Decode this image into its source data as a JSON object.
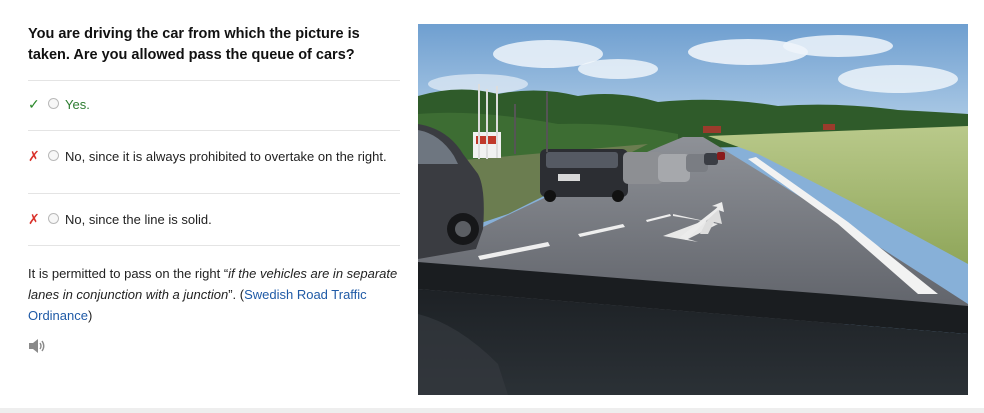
{
  "question": "You are driving the car from which the picture is taken. Are you allowed pass the queue of cars?",
  "answers": [
    {
      "mark": "✓",
      "text": "Yes.",
      "status": "correct"
    },
    {
      "mark": "✗",
      "text": "No, since it is always prohibited to overtake on the right.",
      "status": "wrong"
    },
    {
      "mark": "✗",
      "text": "No, since the line is solid.",
      "status": "wrong"
    }
  ],
  "explanation": {
    "intro": "It is permitted to pass on the right “",
    "quote": "if the vehicles are in separate lanes in conjunction with a junction",
    "outro": "”. (",
    "source_link": "Swedish Road Traffic Ordinance",
    "close": ")"
  },
  "speaker_icon": "speaker-icon",
  "photo_description_icon": "road-photo",
  "colors": {
    "correct": "#2e7d32",
    "wrong": "#d9322b",
    "link": "#1f5aa6"
  }
}
